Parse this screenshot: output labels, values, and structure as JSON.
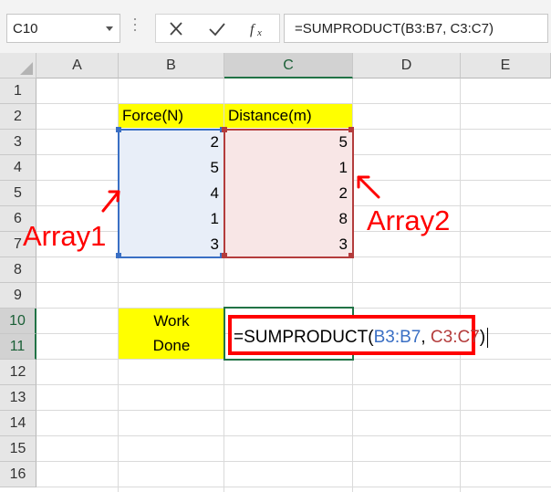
{
  "formula_bar": {
    "name_box": "C10",
    "cancel_icon": "cancel-icon",
    "enter_icon": "checkmark-icon",
    "function_icon": "insert-function-icon",
    "formula": "=SUMPRODUCT(B3:B7, C3:C7)"
  },
  "columns": [
    "A",
    "B",
    "C",
    "D",
    "E"
  ],
  "rows": [
    "1",
    "2",
    "3",
    "4",
    "5",
    "6",
    "7",
    "8",
    "9",
    "10",
    "11",
    "12",
    "13",
    "14",
    "15",
    "16"
  ],
  "selected_column": "C",
  "selected_rows": [
    "10",
    "11"
  ],
  "table": {
    "header_force": "Force(N)",
    "header_distance": "Distance(m)",
    "force": [
      "2",
      "5",
      "4",
      "1",
      "3"
    ],
    "distance": [
      "5",
      "1",
      "2",
      "8",
      "3"
    ]
  },
  "work_done": {
    "line1": "Work",
    "line2": "Done"
  },
  "edit": {
    "prefix": "=SUMPRODUCT(",
    "ref_b": "B3:B7",
    "sep": ", ",
    "ref_c": "C3:C7",
    "suffix": ")"
  },
  "annotations": {
    "array1": "Array1",
    "array2": "Array2"
  },
  "colors": {
    "accent_green": "#217346",
    "range_blue": "#3a6fc4",
    "range_red": "#b43c3c",
    "highlight_yellow": "#ffff00",
    "annotation_red": "#ff0000"
  }
}
